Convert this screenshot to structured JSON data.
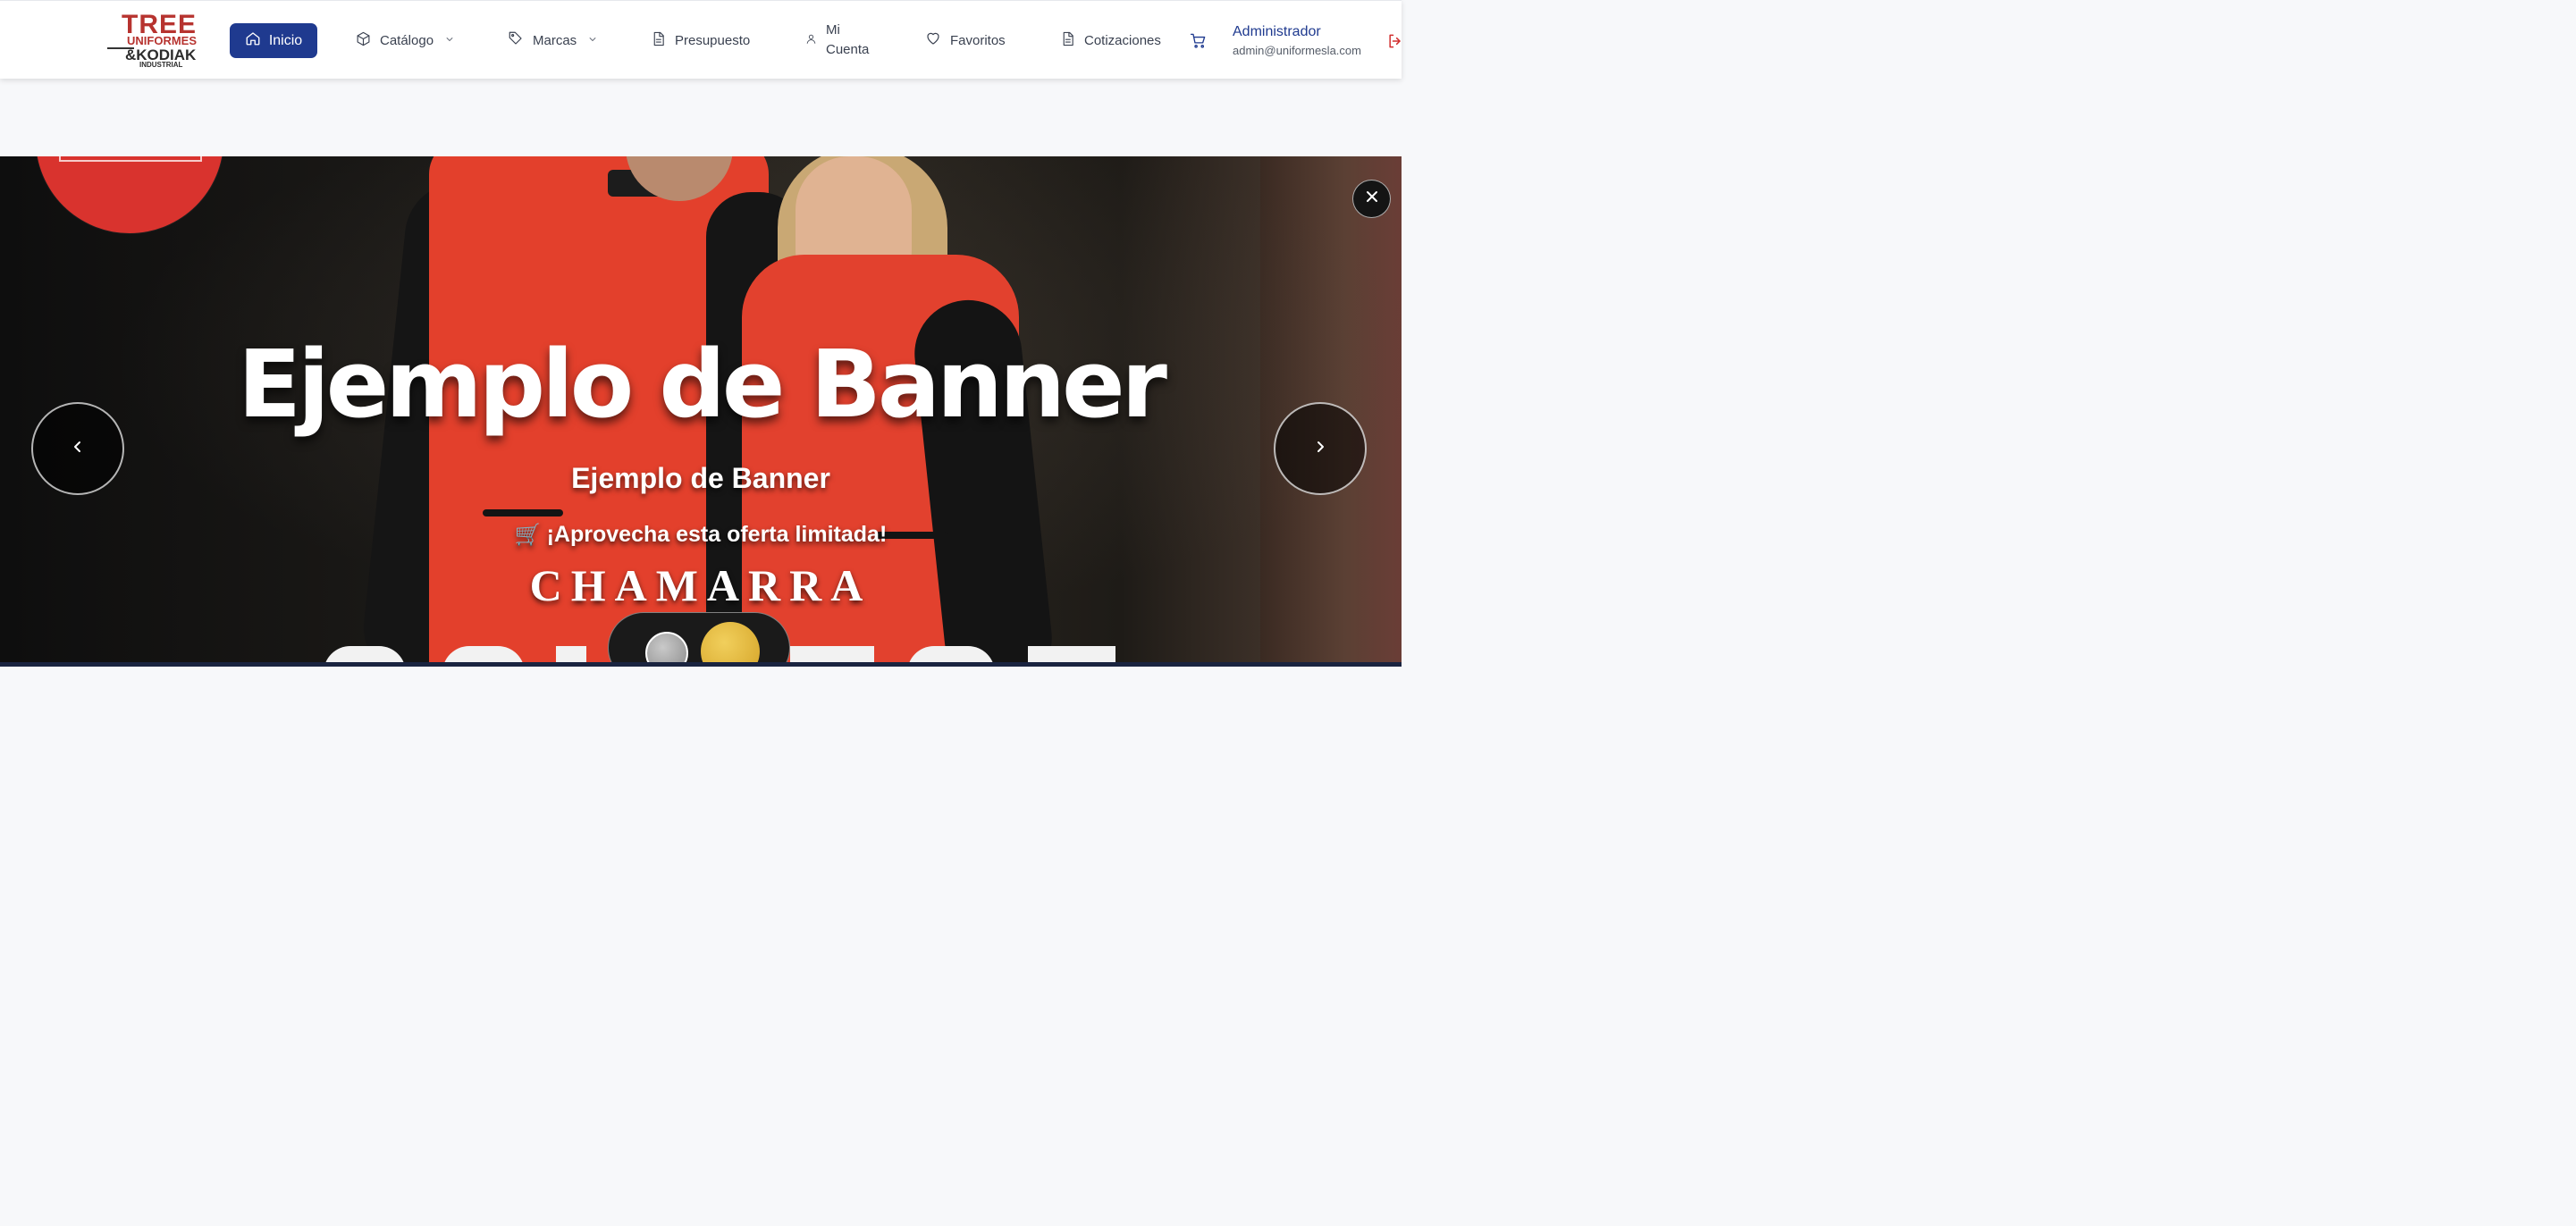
{
  "brand": {
    "logo_line1": "TREE",
    "logo_line2": "UNIFORMES",
    "logo_line3": "&KODIAK",
    "logo_line4": "INDUSTRIAL",
    "primary_color": "#1f3a8f",
    "accent_red": "#b7332f"
  },
  "nav": {
    "home": "Inicio",
    "catalog": "Catálogo",
    "brands": "Marcas",
    "budget": "Presupuesto",
    "account_line1": "Mi",
    "account_line2": "Cuenta",
    "favorites": "Favoritos",
    "quotes": "Cotizaciones"
  },
  "user": {
    "name": "Administrador",
    "email": "admin@uniformesla.com"
  },
  "banner": {
    "title": "Ejemplo de Banner",
    "subtitle": "Ejemplo de Banner",
    "offer_icon": "🛒",
    "offer": "¡Aprovecha esta oferta limitada!",
    "product": "CHAMARRA",
    "color_options": [
      "gray",
      "gold"
    ],
    "selected_color": "gold"
  },
  "icons": {
    "home": "home-icon",
    "catalog": "box-icon",
    "brands": "tag-icon",
    "budget": "document-icon",
    "account": "user-icon",
    "favorites": "heart-icon",
    "quotes": "document-icon",
    "cart": "cart-icon",
    "logout": "logout-icon",
    "close": "close-icon",
    "prev": "chevron-left-icon",
    "next": "chevron-right-icon"
  }
}
